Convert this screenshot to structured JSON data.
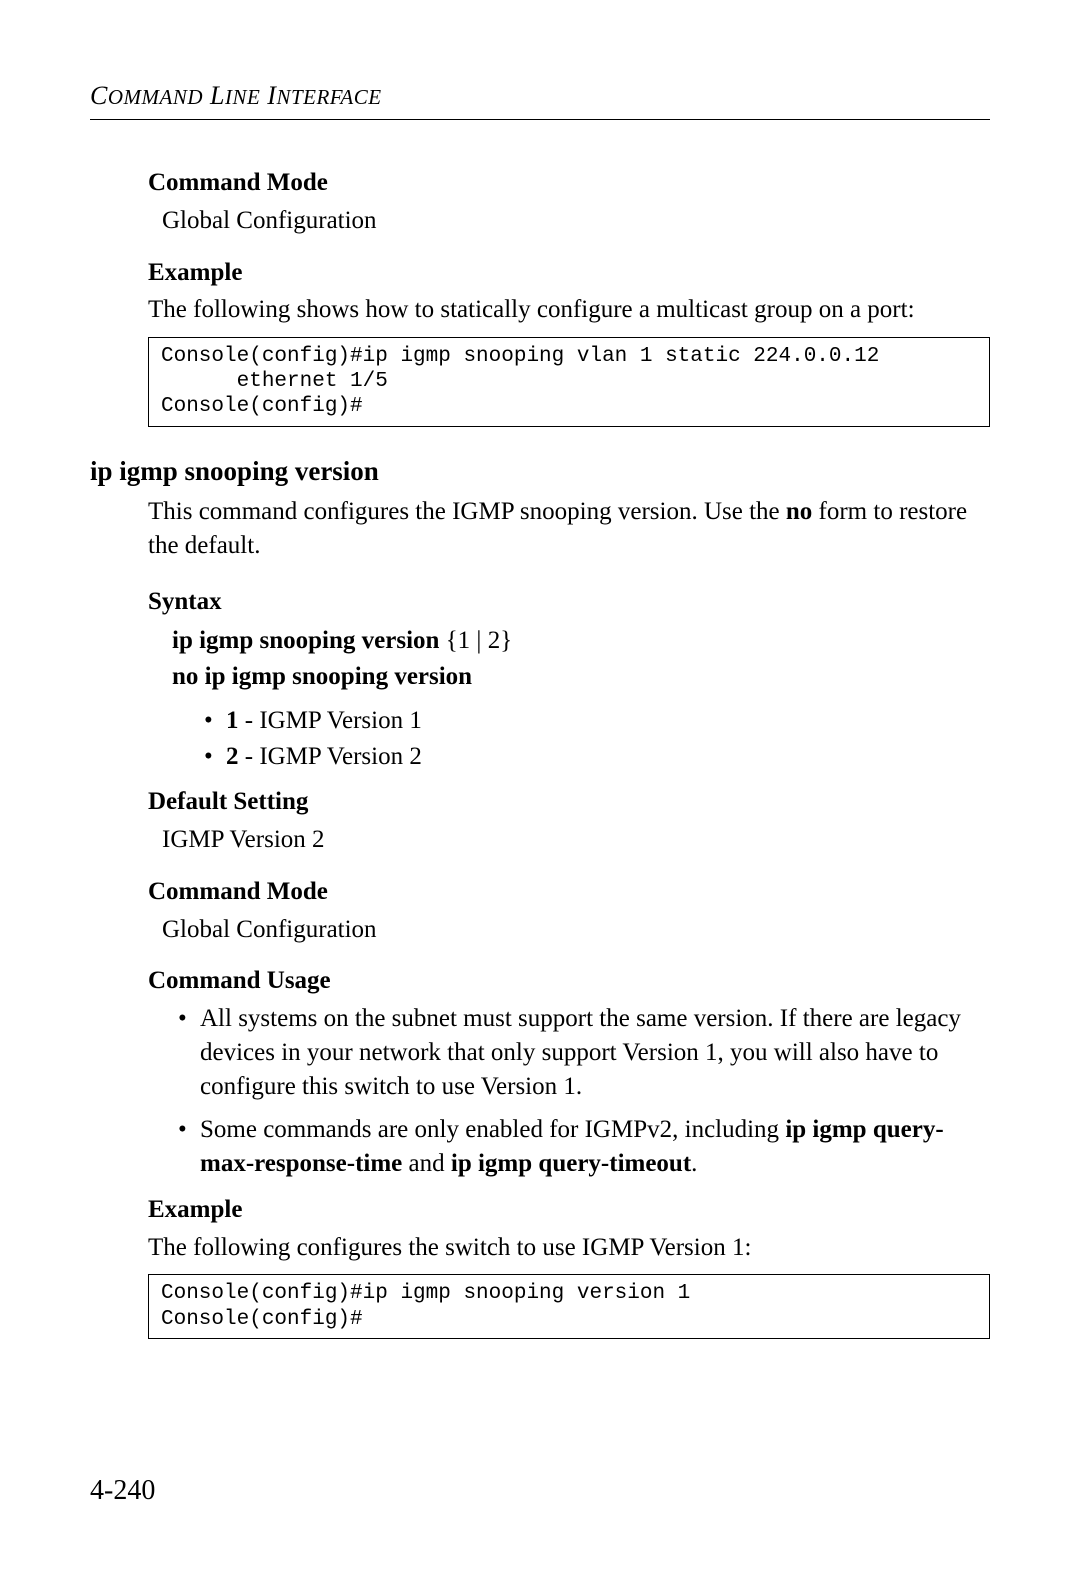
{
  "header": {
    "running": "COMMAND LINE INTERFACE"
  },
  "section1": {
    "cmd_mode_h": "Command Mode",
    "cmd_mode_v": "Global Configuration",
    "example_h": "Example",
    "example_text": "The following shows how to statically configure a multicast group on a port:",
    "code": "Console(config)#ip igmp snooping vlan 1 static 224.0.0.12 \n      ethernet 1/5\nConsole(config)#"
  },
  "cmd": {
    "title": "ip igmp snooping version",
    "desc_pre": "This command configures the IGMP snooping version. Use the ",
    "desc_bold": "no",
    "desc_post": " form to restore the default.",
    "syntax_h": "Syntax",
    "syntax_line1_bold": "ip igmp snooping version",
    "syntax_line1_rest": " {1 | 2}",
    "syntax_line2": "no ip igmp snooping version",
    "opts": [
      {
        "key": "1",
        "desc": " - IGMP Version 1"
      },
      {
        "key": "2",
        "desc": " - IGMP Version 2"
      }
    ],
    "default_h": "Default Setting",
    "default_v": "IGMP Version 2",
    "cmd_mode_h": "Command Mode",
    "cmd_mode_v": "Global Configuration",
    "usage_h": "Command Usage",
    "usage": [
      {
        "pre": "All systems on the subnet must support the same version. If there are legacy devices in your network that only support Version 1, you will also have to configure this switch to use Version 1.",
        "b1": "",
        "mid": "",
        "b2": "",
        "post": ""
      },
      {
        "pre": "Some commands are only enabled for IGMPv2, including ",
        "b1": "ip igmp query-max-response-time",
        "mid": " and ",
        "b2": "ip igmp query-timeout",
        "post": "."
      }
    ],
    "example_h": "Example",
    "example_text": "The following configures the switch to use IGMP Version 1:",
    "code": "Console(config)#ip igmp snooping version 1\nConsole(config)#"
  },
  "page_number": "4-240"
}
